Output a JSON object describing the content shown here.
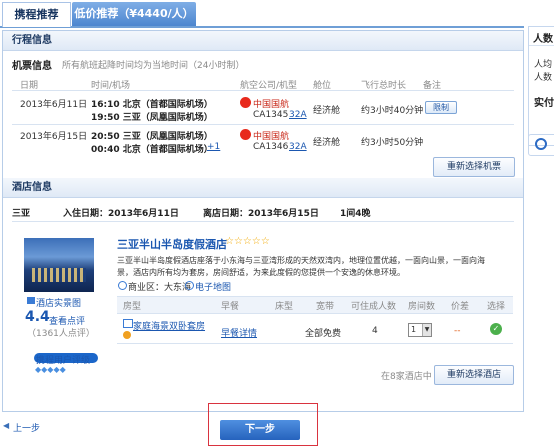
{
  "tabs": [
    {
      "label": "携程推荐",
      "active": true
    },
    {
      "label": "低价推荐（¥4440/人）",
      "active": false
    }
  ],
  "itinerary": {
    "section_title": "行程信息",
    "flight_title": "机票信息",
    "flight_note": "所有航班起降时间均为当地时间（24小时制）",
    "columns": [
      "日期",
      "时间/机场",
      "航空公司/机型",
      "舱位",
      "飞行总时长",
      "备注"
    ],
    "legs": [
      {
        "date": "2013年6月11日",
        "dep": "16:10 北京（首都国际机场）",
        "arr": "19:50 三亚（凤凰国际机场）",
        "airline": "中国国航",
        "flight": "CA1345",
        "plane": "32A",
        "cabin": "经济舱",
        "duration": "约3小时40分钟",
        "remark": "限制"
      },
      {
        "date": "2013年6月15日",
        "dep": "20:50 三亚（凤凰国际机场）",
        "arr": "00:40 北京（首都国际机场）",
        "day_offset": "+1",
        "airline": "中国国航",
        "flight": "CA1346",
        "plane": "32A",
        "cabin": "经济舱",
        "duration": "约3小时50分钟"
      }
    ],
    "reselect_button": "重新选择机票"
  },
  "hotel": {
    "section_title": "酒店信息",
    "city": "三亚",
    "checkin": "入住日期：2013年6月11日",
    "checkout": "离店日期：2013年6月15日",
    "nights": "1间4晚",
    "name": "三亚半山半岛度假酒店",
    "stars": "☆☆☆☆☆",
    "desc_line1": "三亚半山半岛度假酒店座落于小东海与三亚湾形成的天然双湾内，地理位置优越，一面向山景，一面向海",
    "desc_line2": "景，酒店内所有均为套房，房间舒适，为来此度假的您提供一个安逸的休息环境。",
    "district": "商业区：大东海",
    "map_link": "电子地图",
    "photo_link": "酒店实景图",
    "score": "4.4",
    "review_link": "查看点评",
    "review_count": "（1361人点评）",
    "user_rating": "携程用户评级",
    "room_columns": [
      "房型",
      "早餐",
      "床型",
      "宽带",
      "可住成人数",
      "房间数",
      "价差",
      "选择"
    ],
    "room": {
      "type": "家庭海景双卧套房",
      "breakfast": "早餐详情",
      "bed": "",
      "broadband": "全部免费",
      "adults": "4",
      "rooms": "1",
      "price_diff": "--"
    },
    "hotel_count_note": "在8家酒店中",
    "reselect_button": "重新选择酒店"
  },
  "nav": {
    "prev": "上一步",
    "next": "下一步"
  },
  "side": {
    "title": "人数",
    "line1": "人均",
    "line2": "人数",
    "line3": "实付"
  },
  "colors": {
    "accent": "#1b57b0",
    "tab_active_border": "#a9c3e6",
    "next_button": "#2c6fc8",
    "check_green": "#4cb04c",
    "highlight_box": "#d9333f"
  }
}
